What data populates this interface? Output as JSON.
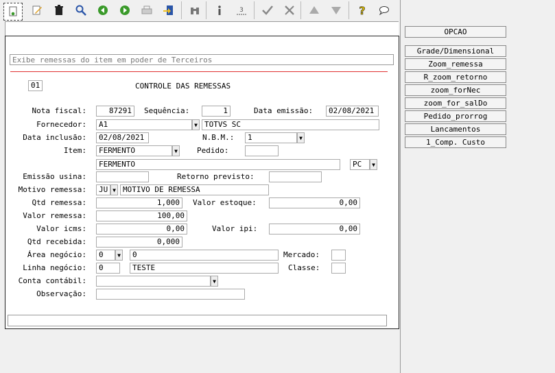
{
  "form": {
    "description": "Exibe remessas do item em poder de Terceiros",
    "code": "01",
    "title": "CONTROLE DAS REMESSAS",
    "labels": {
      "nota_fiscal": "Nota fiscal:",
      "sequencia": "Sequência:",
      "data_emissao": "Data emissão:",
      "fornecedor": "Fornecedor:",
      "data_inclusao": "Data inclusão:",
      "nbm": "N.B.M.:",
      "item": "Item:",
      "pedido": "Pedido:",
      "emissao_usina": "Emissão usina:",
      "retorno_previsto": "Retorno previsto:",
      "motivo_remessa": "Motivo remessa:",
      "qtd_remessa": "Qtd remessa:",
      "valor_estoque": "Valor estoque:",
      "valor_remessa": "Valor remessa:",
      "valor_icms": "Valor icms:",
      "valor_ipi": "Valor ipi:",
      "qtd_recebida": "Qtd recebida:",
      "area_negocio": "Área negócio:",
      "mercado": "Mercado:",
      "linha_negocio": "Linha negócio:",
      "classe": "Classe:",
      "conta_contabil": "Conta contábil:",
      "observacao": "Observação:"
    },
    "values": {
      "nota_fiscal": "87291",
      "sequencia": "1",
      "data_emissao": "02/08/2021",
      "fornecedor_code": "A1",
      "fornecedor_name": "TOTVS SC",
      "data_inclusao": "02/08/2021",
      "nbm": "1",
      "item": "FERMENTO",
      "pedido": "",
      "item_desc": "FERMENTO",
      "unit": "PC",
      "emissao_usina": "",
      "retorno_previsto": "",
      "motivo_code": "JU",
      "motivo_desc": "MOTIVO DE REMESSA",
      "qtd_remessa": "1,000",
      "valor_estoque": "0,00",
      "valor_remessa": "100,00",
      "valor_icms": "0,00",
      "valor_ipi": "0,00",
      "qtd_recebida": "0,000",
      "area_negocio_code": "0",
      "area_negocio_desc": "0",
      "mercado": "",
      "linha_negocio_code": "0",
      "linha_negocio_desc": "TESTE",
      "classe": "",
      "conta_contabil": "",
      "observacao": ""
    }
  },
  "side_panel": {
    "header": "OPCAO",
    "buttons": [
      "Grade/Dimensional",
      "Zoom_remessa",
      "R_zoom_retorno",
      "zoom_forNec",
      "zoom_for_salDo",
      "Pedido_prorrog",
      "Lancamentos",
      "1_Comp. Custo"
    ]
  },
  "toolbar_icons": [
    "new-icon",
    "edit-icon",
    "delete-icon",
    "search-icon",
    "previous-icon",
    "next-icon",
    "print-icon",
    "export-icon",
    "binoculars-icon",
    "info-icon",
    "numbering-icon",
    "check-icon",
    "tools-icon",
    "up-icon",
    "down-icon",
    "help-icon",
    "chat-icon"
  ],
  "colors": {
    "accent_red": "#e03030",
    "icon_green": "#3a9a2a",
    "icon_blue": "#2a55a8"
  }
}
